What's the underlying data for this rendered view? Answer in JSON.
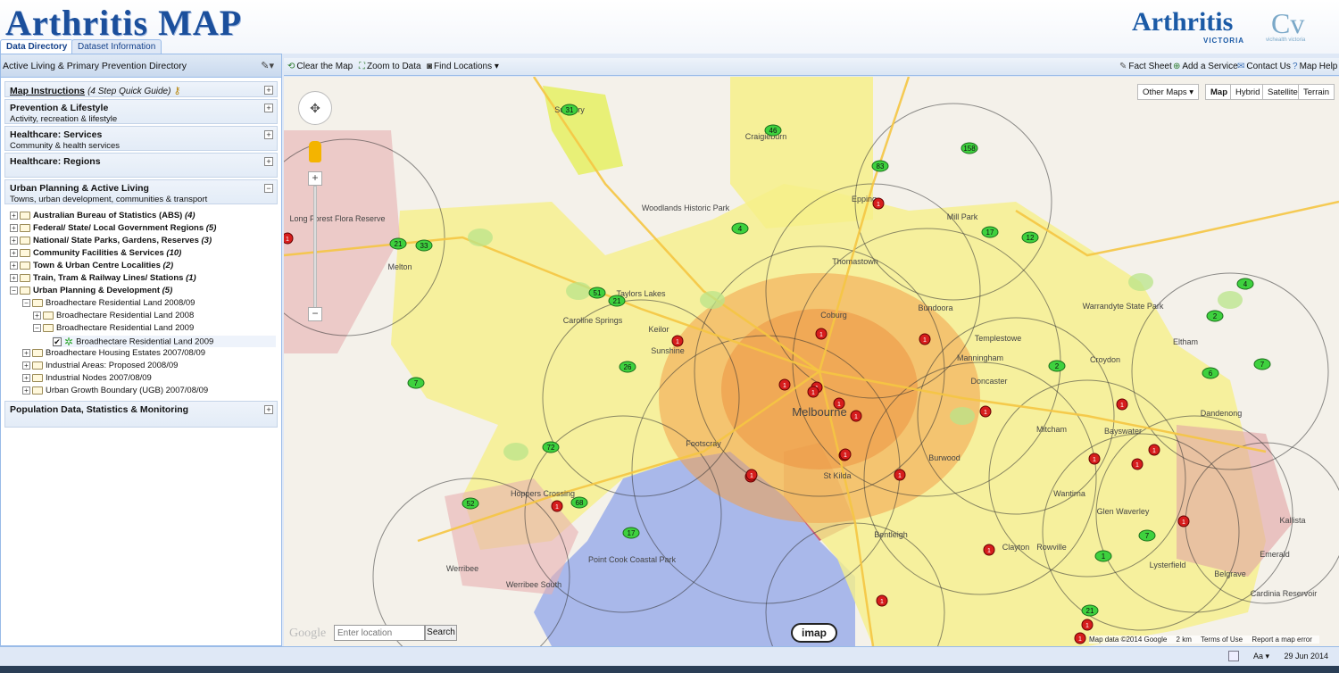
{
  "header": {
    "logo": "Arthritis MAP",
    "brand_right": "Arthritis",
    "brand_right_sub": "VICTORIA",
    "partner_sub": "vichealth victoria",
    "tabs": [
      "Data Directory",
      "Dataset Information"
    ]
  },
  "sidebar": {
    "title": "Active Living & Primary Prevention Directory",
    "sections": [
      {
        "title": "Map Instructions",
        "subtitle_inline": "(4 Step Quick Guide)"
      },
      {
        "title": "Prevention & Lifestyle",
        "subtitle": "Activity, recreation & lifestyle"
      },
      {
        "title": "Healthcare: Services",
        "subtitle": "Community & health services"
      },
      {
        "title": "Healthcare: Regions",
        "subtitle": ""
      },
      {
        "title": "Urban Planning & Active Living",
        "subtitle": "Towns, urban development, communities & transport"
      }
    ],
    "tree": [
      {
        "label": "Australian Bureau of Statistics (ABS)",
        "count": "(4)"
      },
      {
        "label": "Federal/ State/ Local Government Regions",
        "count": "(5)"
      },
      {
        "label": "National/ State Parks, Gardens, Reserves",
        "count": "(3)"
      },
      {
        "label": "Community Facilities & Services",
        "count": "(10)"
      },
      {
        "label": "Town & Urban Centre Localities",
        "count": "(2)"
      },
      {
        "label": "Train, Tram & Railway Lines/ Stations",
        "count": "(1)"
      },
      {
        "label": "Urban Planning & Development",
        "count": "(5)"
      }
    ],
    "subtree": [
      "Broadhectare Residential Land 2008/09",
      "Broadhectare Residential Land 2008",
      "Broadhectare Residential Land 2009",
      "Broadhectare Residential Land 2009",
      "Broadhectare Housing Estates 2007/08/09",
      "Industrial Areas: Proposed 2008/09",
      "Industrial Nodes 2007/08/09",
      "Urban Growth Boundary (UGB) 2007/08/09"
    ],
    "bottom_section": "Population Data, Statistics & Monitoring"
  },
  "toolbar": {
    "clear": "Clear the Map",
    "zoom": "Zoom to Data",
    "find": "Find Locations",
    "fact": "Fact Sheet",
    "add": "Add a Service",
    "contact": "Contact Us",
    "help": "Map Help"
  },
  "map": {
    "map_types": [
      "Other Maps",
      "Map",
      "Hybrid",
      "Satellite",
      "Terrain"
    ],
    "search_placeholder": "Enter location",
    "search_button": "Search",
    "google": "Google",
    "imap": "imap",
    "attribution": [
      "Map data ©2014 Google",
      "2 km",
      "Terms of Use",
      "Report a map error"
    ],
    "green_markers": [
      "31",
      "46",
      "158",
      "83",
      "21",
      "33",
      "4",
      "17",
      "12",
      "51",
      "21",
      "26",
      "7",
      "72",
      "52",
      "68",
      "17",
      "2",
      "2",
      "6",
      "7",
      "7",
      "1",
      "4",
      "21"
    ],
    "red_marker_label": "1",
    "place_labels": [
      "Melbourne",
      "Manningham",
      "Doncaster",
      "Mitcham",
      "Werribee",
      "Hoppers Crossing",
      "Sunshine",
      "Footscray",
      "St Kilda",
      "Bundoora",
      "Epping",
      "Craigieburn",
      "Taylors Lakes",
      "Croydon",
      "Dandenong",
      "Bentleigh",
      "Clayton",
      "Bayswater",
      "Wantirna",
      "Point Cook Coastal Park",
      "Long Forest Flora Reserve",
      "Woodlands Historic Park",
      "Warrandyte State Park",
      "Cardinia Reservoir",
      "Belgrave",
      "Emerald",
      "Kallista",
      "Lysterfield",
      "Rowville",
      "Werribee South",
      "Melton",
      "Caroline Springs",
      "Keilor",
      "Coburg",
      "Thomastown",
      "Templestowe",
      "Burwood",
      "Glen Waverley",
      "Eltham",
      "Mill Park",
      "Sunbury"
    ]
  },
  "status": {
    "date": "29 Jun 2014",
    "aa": "Aa"
  }
}
